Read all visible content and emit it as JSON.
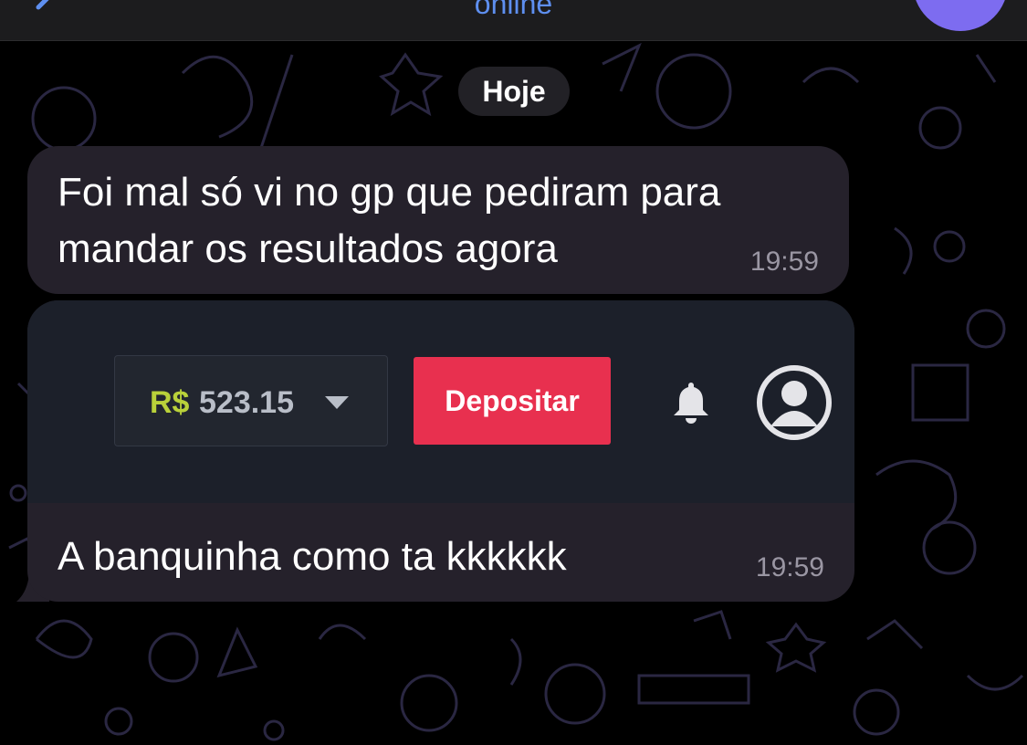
{
  "header": {
    "status": "online",
    "back_icon": "chevron-left-icon",
    "avatar": "avatar",
    "status_color": "#5e8ff0"
  },
  "date_divider": "Hoje",
  "messages": [
    {
      "text": "Foi mal só vi no gp que pediram para mandar os resultados agora",
      "time": "19:59"
    },
    {
      "attachment": {
        "currency": "R$",
        "balance": "523.15",
        "dropdown_icon": "caret-down-icon",
        "deposit_label": "Depositar",
        "notification_icon": "bell-icon",
        "account_icon": "user-circle-icon",
        "deposit_color": "#e8304f",
        "currency_color": "#b9d13a"
      },
      "text": "A banquinha como ta kkkkkk",
      "time": "19:59"
    }
  ],
  "colors": {
    "background": "#000000",
    "bubble": "#25212b",
    "doodle": "#2a2742"
  }
}
